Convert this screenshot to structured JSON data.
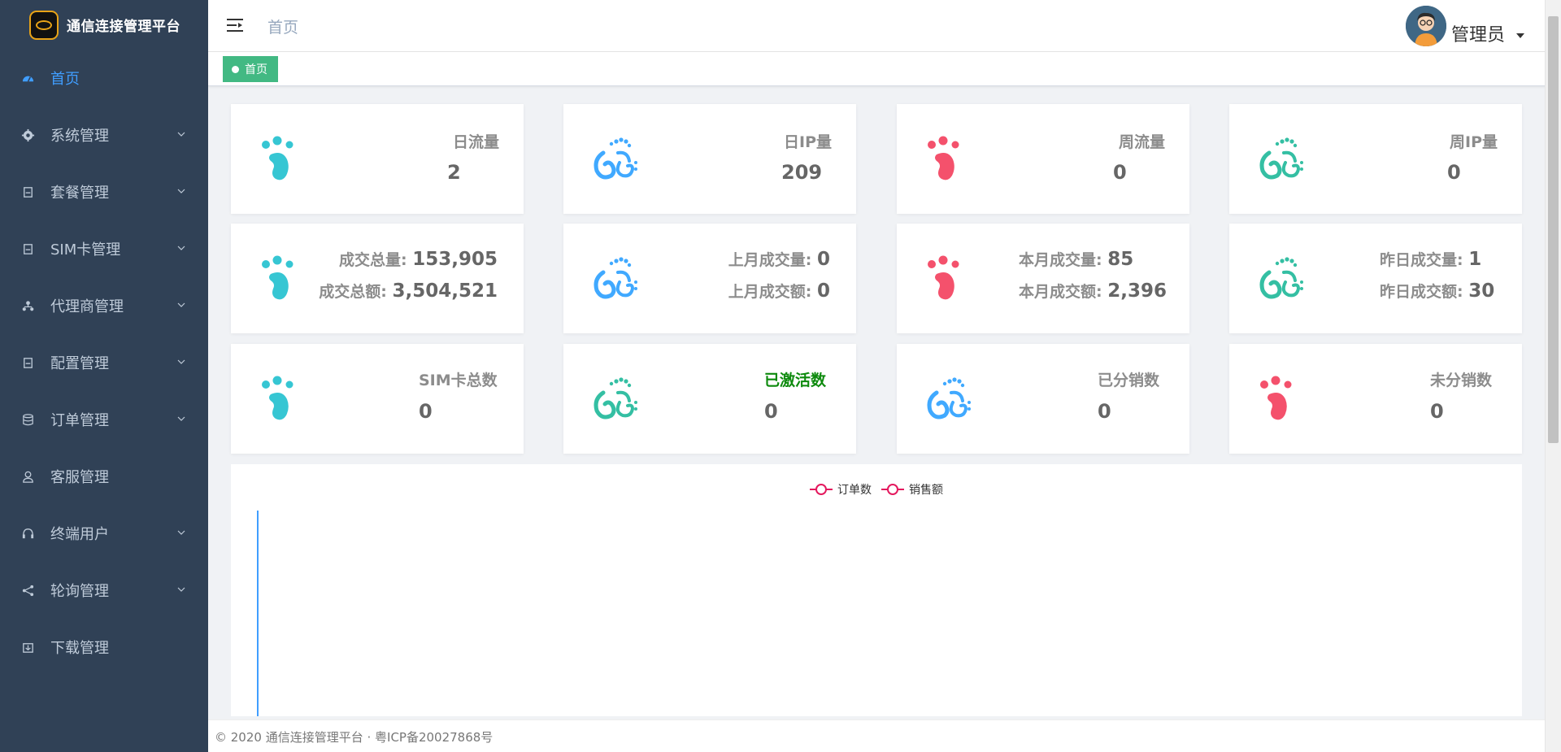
{
  "app": {
    "title": "通信连接管理平台"
  },
  "sidebar": {
    "items": [
      {
        "label": "首页",
        "icon": "dashboard-icon",
        "active": true,
        "submenu": false
      },
      {
        "label": "系统管理",
        "icon": "gear-icon",
        "submenu": true
      },
      {
        "label": "套餐管理",
        "icon": "package-icon",
        "submenu": true
      },
      {
        "label": "SIM卡管理",
        "icon": "simcard-icon",
        "submenu": true
      },
      {
        "label": "代理商管理",
        "icon": "org-icon",
        "submenu": true
      },
      {
        "label": "配置管理",
        "icon": "config-icon",
        "submenu": true
      },
      {
        "label": "订单管理",
        "icon": "database-icon",
        "submenu": true
      },
      {
        "label": "客服管理",
        "icon": "user-service-icon",
        "submenu": false
      },
      {
        "label": "终端用户",
        "icon": "headset-icon",
        "submenu": true
      },
      {
        "label": "轮询管理",
        "icon": "share-icon",
        "submenu": true
      },
      {
        "label": "下载管理",
        "icon": "download-icon",
        "submenu": false
      }
    ]
  },
  "header": {
    "breadcrumb": "首页",
    "username": "管理员"
  },
  "tags": [
    {
      "label": "首页"
    }
  ],
  "stats": {
    "row1": [
      {
        "label": "日流量",
        "value": "2",
        "color": "#36c6d3"
      },
      {
        "label": "日IP量",
        "value": "209",
        "color": "#40a9ff"
      },
      {
        "label": "周流量",
        "value": "0",
        "color": "#f4516c"
      },
      {
        "label": "周IP量",
        "value": "0",
        "color": "#34bfa3"
      }
    ],
    "row2": [
      {
        "line1_label": "成交总量:",
        "line1_value": "153,905",
        "line2_label": "成交总额:",
        "line2_value": "3,504,521",
        "color": "#36c6d3"
      },
      {
        "line1_label": "上月成交量:",
        "line1_value": "0",
        "line2_label": "上月成交额:",
        "line2_value": "0",
        "color": "#40a9ff"
      },
      {
        "line1_label": "本月成交量:",
        "line1_value": "85",
        "line2_label": "本月成交额:",
        "line2_value": "2,396",
        "color": "#f4516c"
      },
      {
        "line1_label": "昨日成交量:",
        "line1_value": "1",
        "line2_label": "昨日成交额:",
        "line2_value": "30",
        "color": "#34bfa3"
      }
    ],
    "row3": [
      {
        "label": "SIM卡总数",
        "value": "0",
        "color": "#36c6d3"
      },
      {
        "label": "已激活数",
        "value": "0",
        "color": "#34bfa3",
        "label_color": "#0d8a0d"
      },
      {
        "label": "已分销数",
        "value": "0",
        "color": "#40a9ff"
      },
      {
        "label": "未分销数",
        "value": "0",
        "color": "#f4516c"
      }
    ]
  },
  "chart_data": {
    "type": "line",
    "series": [
      {
        "name": "订单数",
        "values": []
      },
      {
        "name": "销售额",
        "values": []
      }
    ],
    "legend_position": "top-center",
    "color": "#e4195e"
  },
  "footer": {
    "text": "© 2020 通信连接管理平台 · 粤ICP备20027868号"
  }
}
